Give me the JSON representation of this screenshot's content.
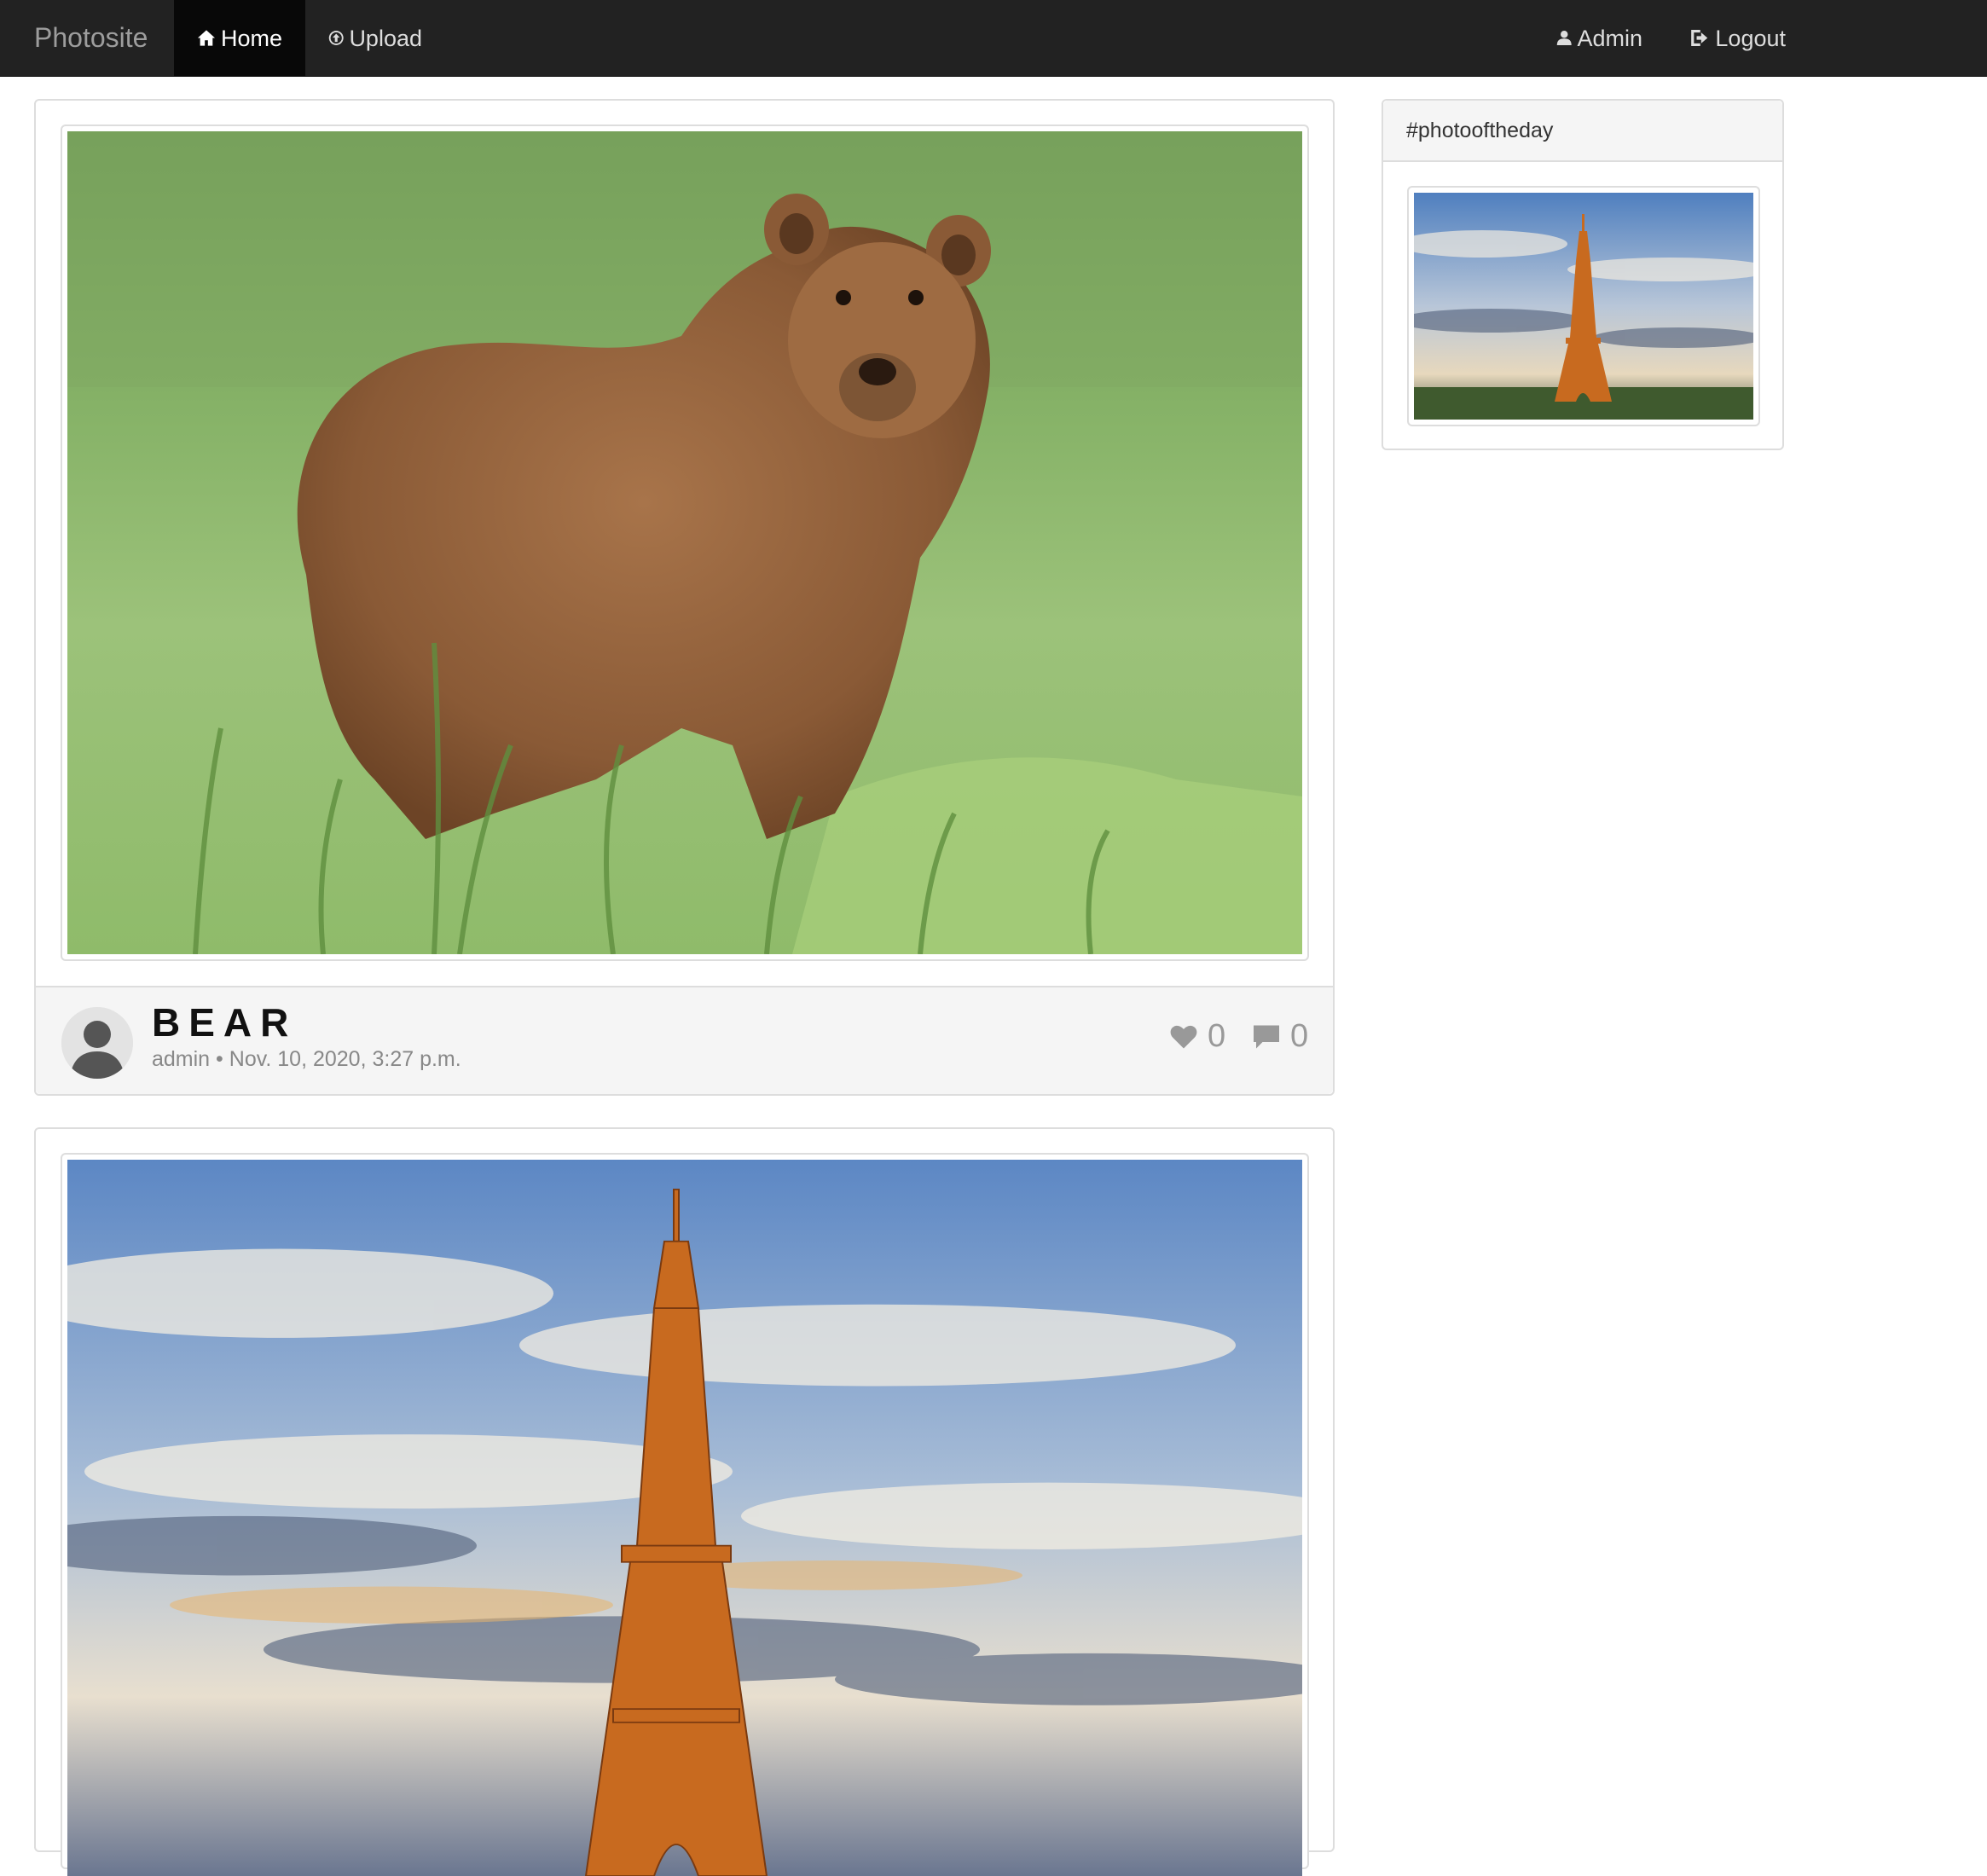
{
  "navbar": {
    "brand": "Photosite",
    "home_label": "Home",
    "upload_label": "Upload",
    "admin_label": "Admin",
    "logout_label": "Logout"
  },
  "posts": [
    {
      "title": "BEAR",
      "author": "admin",
      "separator": "•",
      "date": "Nov. 10, 2020, 3:27 p.m.",
      "likes": "0",
      "comments": "0",
      "image": "brown-bear-photo"
    },
    {
      "image": "eiffel-tower-photo"
    }
  ],
  "sidebar": {
    "panel_title": "#photooftheday",
    "image": "eiffel-tower-photo"
  },
  "colors": {
    "navbar_bg": "#222222",
    "active_nav_bg": "#080808",
    "footer_bg": "#f5f5f5",
    "border": "#dddddd"
  }
}
